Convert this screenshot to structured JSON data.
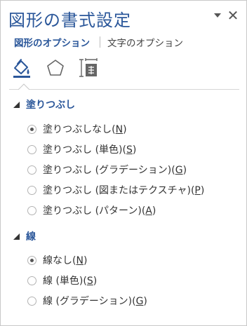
{
  "title": "図形の書式設定",
  "header_controls": {
    "dropdown_icon": "chevron-down-icon",
    "close_glyph": "✕"
  },
  "tabs": [
    {
      "label": "図形のオプション",
      "active": true
    },
    {
      "label": "文字のオプション",
      "active": false
    }
  ],
  "category_icons": [
    "fill-line-icon",
    "effects-pentagon-icon",
    "size-properties-icon"
  ],
  "sections": {
    "fill": {
      "label": "塗りつぶし",
      "options": [
        {
          "text": "塗りつぶしなし(",
          "key": "N",
          "close": ")",
          "selected": true
        },
        {
          "text": "塗りつぶし (単色)(",
          "key": "S",
          "close": ")",
          "selected": false
        },
        {
          "text": "塗りつぶし (グラデーション)(",
          "key": "G",
          "close": ")",
          "selected": false
        },
        {
          "text": "塗りつぶし (図またはテクスチャ)(",
          "key": "P",
          "close": ")",
          "selected": false
        },
        {
          "text": "塗りつぶし (パターン)(",
          "key": "A",
          "close": ")",
          "selected": false
        }
      ]
    },
    "line": {
      "label": "線",
      "options": [
        {
          "text": "線なし(",
          "key": "N",
          "close": ")",
          "selected": true
        },
        {
          "text": "線 (単色)(",
          "key": "S",
          "close": ")",
          "selected": false
        },
        {
          "text": "線 (グラデーション)(",
          "key": "G",
          "close": ")",
          "selected": false
        }
      ]
    }
  },
  "colors": {
    "accent": "#2b579a",
    "text": "#333333",
    "border": "#c8c8c8"
  }
}
